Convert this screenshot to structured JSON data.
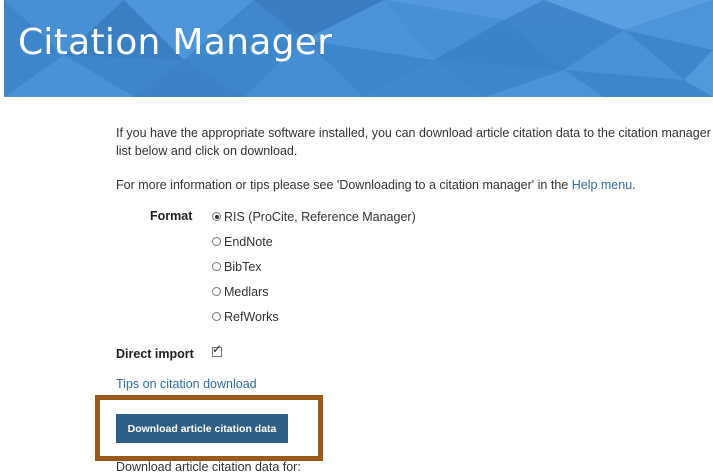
{
  "banner": {
    "title": "Citation Manager"
  },
  "intro": {
    "line1": "If you have the appropriate software installed, you can download article citation data to the citation manager of your choice. Simply select your manager software from the",
    "line2": "list below and click on download."
  },
  "more_info": {
    "prefix": "For more information or tips please see 'Downloading to a citation manager' in the ",
    "link": "Help menu",
    "suffix": "."
  },
  "format": {
    "label": "Format",
    "options": [
      {
        "label": "RIS (ProCite, Reference Manager)",
        "checked": true
      },
      {
        "label": "EndNote",
        "checked": false
      },
      {
        "label": "BibTex",
        "checked": false
      },
      {
        "label": "Medlars",
        "checked": false
      },
      {
        "label": "RefWorks",
        "checked": false
      }
    ]
  },
  "direct_import": {
    "label": "Direct import",
    "checked": true
  },
  "tips_link": "Tips on citation download",
  "download_button": "Download article citation data",
  "download_for": "Download article citation data for:",
  "colors": {
    "banner": "#3d86cc",
    "button": "#2f5f86",
    "highlight": "#9a5a1e",
    "link": "#2f6ea6"
  }
}
